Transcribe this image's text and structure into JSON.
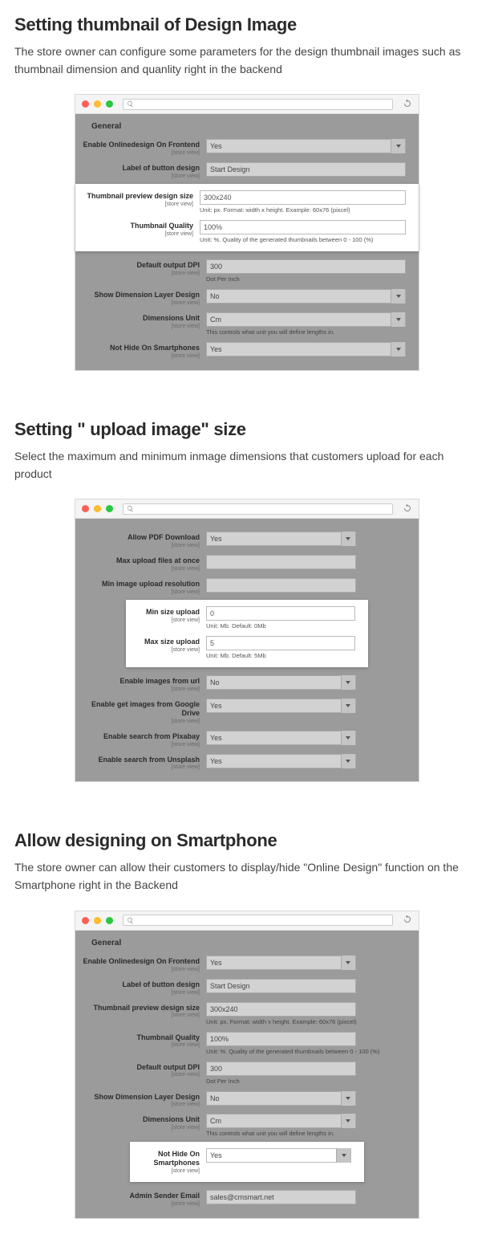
{
  "sections": {
    "s1": {
      "title": "Setting thumbnail of Design Image",
      "desc": "The store owner can configure some parameters for the design thumbnail images such as thumbnail dimension and quanlity right in the backend"
    },
    "s2": {
      "title": "Setting \" upload image\" size",
      "desc": "Select the maximum and minimum inmage dimensions that customers upload for each product"
    },
    "s3": {
      "title": "Allow designing on Smartphone",
      "desc": "The store owner can allow their customers to display/hide \"Online Design\" function on the Smartphone right in the Backend"
    }
  },
  "common": {
    "scope": "[store view]",
    "general": "General"
  },
  "shot1": {
    "enable": {
      "label": "Enable Onlinedesign On Frontend",
      "value": "Yes"
    },
    "btn": {
      "label": "Label of button design",
      "value": "Start Design"
    },
    "thumb": {
      "label": "Thumbnail preview design size",
      "value": "300x240",
      "hint": "Unit: px. Format: width x height. Example: 60x76 (pixcel)"
    },
    "quality": {
      "label": "Thumbnail Quality",
      "value": "100%",
      "hint": "Unit: %. Quality of the generated thumbnails between 0 - 100 (%)"
    },
    "dpi": {
      "label": "Default output DPI",
      "value": "300",
      "hint": "Dot Per Inch"
    },
    "dim": {
      "label": "Show Dimension Layer Design",
      "value": "No"
    },
    "unit": {
      "label": "Dimensions Unit",
      "value": "Cm",
      "hint": "This controls what unit you will define lengths in."
    },
    "phone": {
      "label": "Not Hide On Smartphones",
      "value": "Yes"
    }
  },
  "shot2": {
    "pdf": {
      "label": "Allow PDF Download",
      "value": "Yes"
    },
    "maxup": {
      "label": "Max upload files at once",
      "value": ""
    },
    "minres": {
      "label": "Min image upload resolution",
      "value": ""
    },
    "minsize": {
      "label": "Min size upload",
      "value": "0",
      "hint": "Unit: Mb. Default: 0Mb"
    },
    "maxsize": {
      "label": "Max size upload",
      "value": "5",
      "hint": "Unit: Mb. Default: 5Mb"
    },
    "url": {
      "label": "Enable images from url",
      "value": "No"
    },
    "gdrive": {
      "label": "Enable get images from Google Drive",
      "value": "Yes"
    },
    "pixabay": {
      "label": "Enable search from Pixabay",
      "value": "Yes"
    },
    "unsplash": {
      "label": "Enable search from Unsplash",
      "value": "Yes"
    }
  },
  "shot3": {
    "enable": {
      "label": "Enable Onlinedesign On Frontend",
      "value": "Yes"
    },
    "btn": {
      "label": "Label of button design",
      "value": "Start Design"
    },
    "thumb": {
      "label": "Thumbnail preview design size",
      "value": "300x240",
      "hint": "Unit: px. Format: width x height. Example: 60x76 (pixcel)"
    },
    "quality": {
      "label": "Thumbnail Quality",
      "value": "100%",
      "hint": "Unit: %. Quality of the generated thumbnails between 0 - 100 (%)"
    },
    "dpi": {
      "label": "Default output DPI",
      "value": "300",
      "hint": "Dot Per Inch"
    },
    "dim": {
      "label": "Show Dimension Layer Design",
      "value": "No"
    },
    "unit": {
      "label": "Dimensions Unit",
      "value": "Cm",
      "hint": "This controls what unit you will define lengths in."
    },
    "phone": {
      "label": "Not Hide On Smartphones",
      "value": "Yes"
    },
    "email": {
      "label": "Admin Sender Email",
      "value": "sales@cmsmart.net"
    }
  }
}
